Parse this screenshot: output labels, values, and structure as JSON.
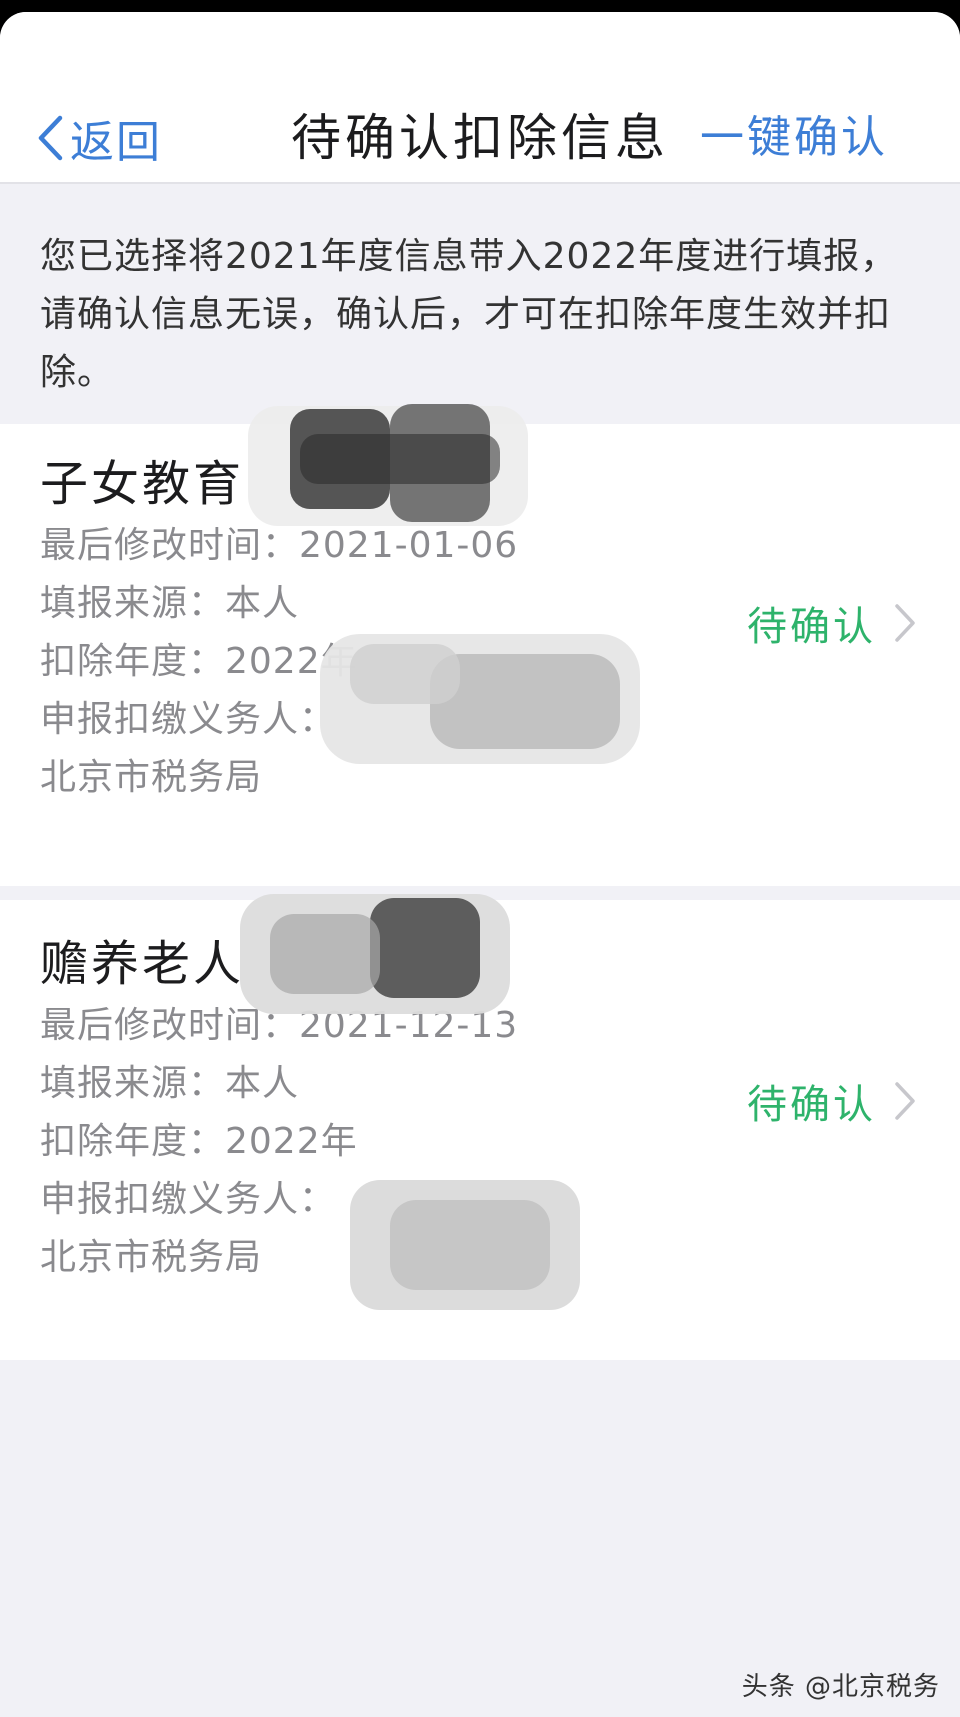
{
  "nav": {
    "back_label": "返回",
    "title": "待确认扣除信息",
    "confirm_all_label": "一键确认"
  },
  "notice": "您已选择将2021年度信息带入2022年度进行填报，请确认信息无误，确认后，才可在扣除年度生效并扣除。",
  "items": [
    {
      "title": "子女教育",
      "modified": "最后修改时间：2021-01-06",
      "source": "填报来源：本人",
      "year": "扣除年度：2022年",
      "agent_label": "申报扣缴义务人：",
      "agent": "北京市税务局",
      "status": "待确认"
    },
    {
      "title": "赡养老人",
      "modified": "最后修改时间：2021-12-13",
      "source": "填报来源：本人",
      "year": "扣除年度：2022年",
      "agent_label": "申报扣缴义务人：",
      "agent": "北京市税务局",
      "status": "待确认"
    }
  ],
  "watermark": "头条 @北京税务",
  "colors": {
    "accent_blue": "#3d7ed6",
    "status_green": "#2eb36b",
    "background": "#f1f1f6"
  }
}
